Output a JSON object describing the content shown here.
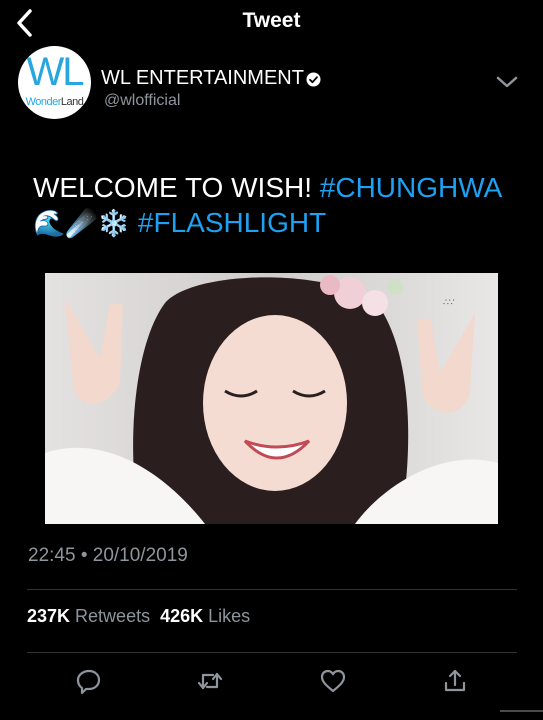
{
  "header": {
    "title": "Tweet",
    "back_icon": "chevron-left-icon"
  },
  "author": {
    "avatar_logo_text": "WL",
    "avatar_subtext_a": "Wonder",
    "avatar_subtext_b": "Land",
    "display_name": "WL ENTERTAINMENT",
    "handle": "@wlofficial",
    "verified_icon": "verified-badge-icon",
    "menu_icon": "chevron-down-icon"
  },
  "tweet": {
    "text_plain": "WELCOME TO WISH! ",
    "hashtag_1": "#CHUNGHWA",
    "emoji_1": "🌊",
    "emoji_2": "☄️",
    "emoji_3": "❄️",
    "hashtag_2": "#FLASHLIGHT"
  },
  "meta": {
    "time": "22:45",
    "separator": "•",
    "date": "20/10/2019"
  },
  "stats": {
    "retweets_count": "237K",
    "retweets_label": "Retweets",
    "likes_count": "426K",
    "likes_label": "Likes"
  },
  "actions": {
    "reply_icon": "reply-icon",
    "retweet_icon": "retweet-icon",
    "like_icon": "heart-icon",
    "share_icon": "share-icon"
  },
  "colors": {
    "background": "#000000",
    "hashtag": "#1da1f2",
    "secondary_text": "#8e959c",
    "divider": "#2f3336"
  }
}
